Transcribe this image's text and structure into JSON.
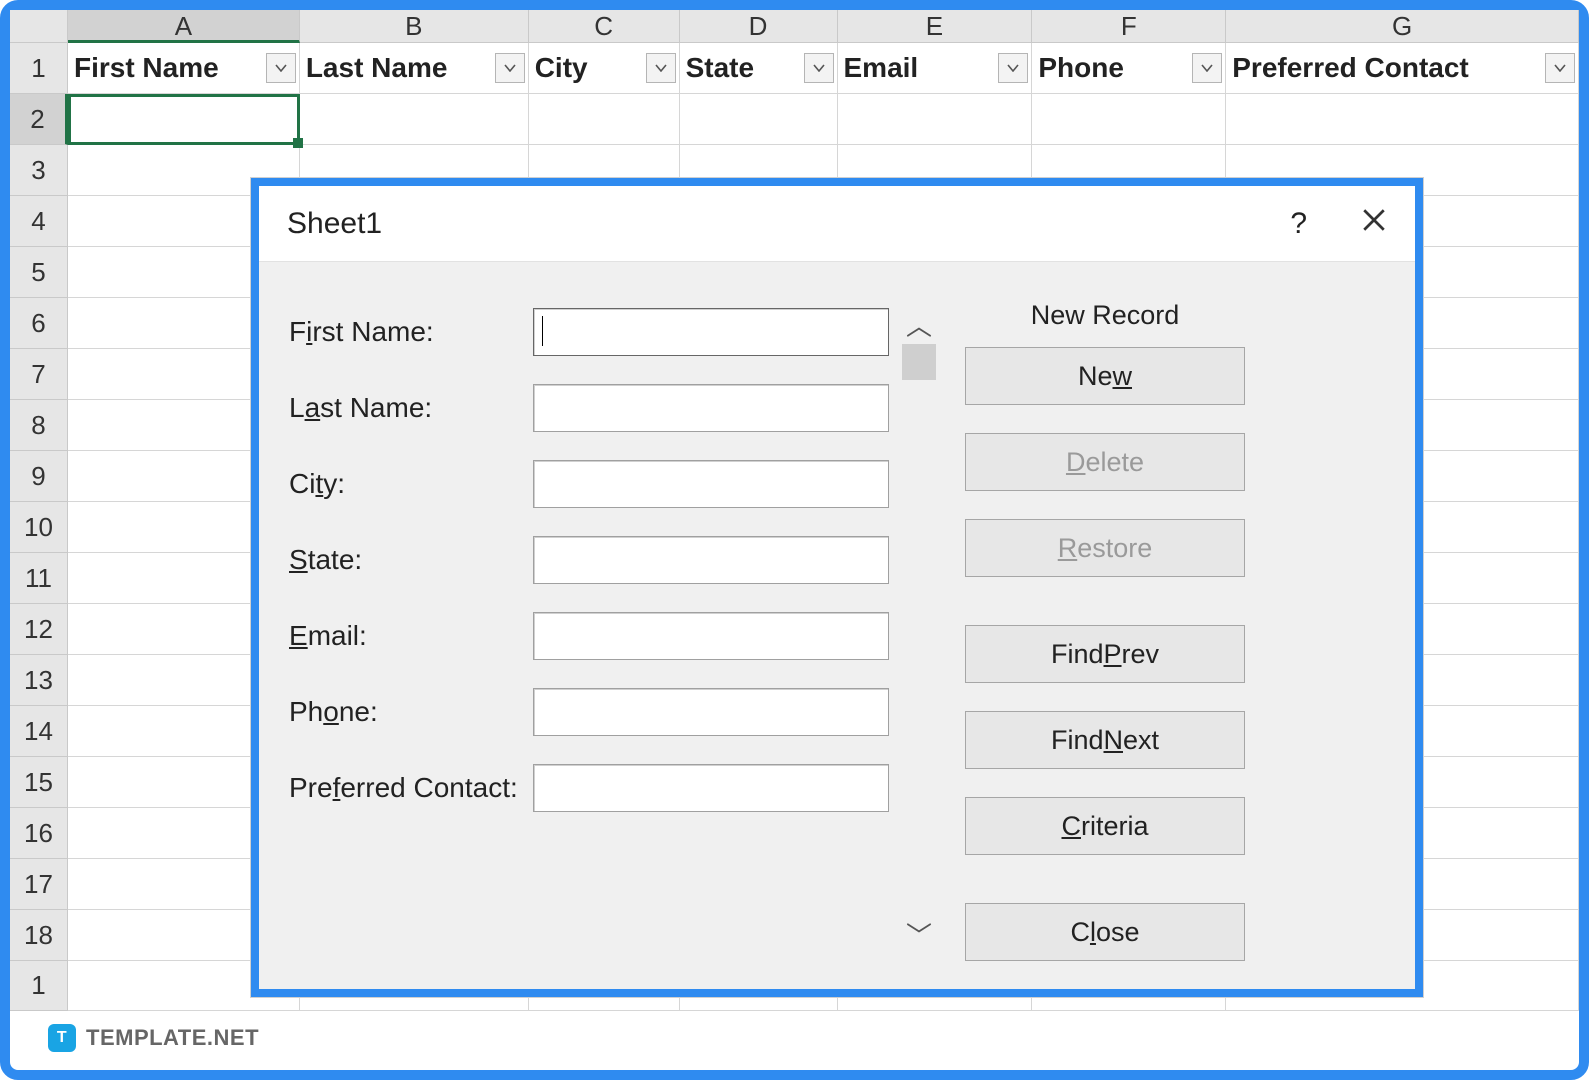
{
  "spreadsheet": {
    "columns": [
      "A",
      "B",
      "C",
      "D",
      "E",
      "F",
      "G"
    ],
    "selected_col": "A",
    "row_numbers": [
      "1",
      "2",
      "3",
      "4",
      "5",
      "6",
      "7",
      "8",
      "9",
      "10",
      "11",
      "12",
      "13",
      "14",
      "15",
      "16",
      "17",
      "18",
      "1"
    ],
    "selected_row": "2",
    "headers": [
      "First Name",
      "Last Name",
      "City",
      "State",
      "Email",
      "Phone",
      "Preferred Contact"
    ]
  },
  "dialog": {
    "title": "Sheet1",
    "help_symbol": "?",
    "status": "New Record",
    "fields": [
      {
        "label_pre": "F",
        "label_ul": "i",
        "label_post": "rst Name:",
        "focused": true
      },
      {
        "label_pre": "L",
        "label_ul": "a",
        "label_post": "st Name:"
      },
      {
        "label_pre": "Ci",
        "label_ul": "t",
        "label_post": "y:"
      },
      {
        "label_pre": "",
        "label_ul": "S",
        "label_post": "tate:"
      },
      {
        "label_pre": "",
        "label_ul": "E",
        "label_post": "mail:"
      },
      {
        "label_pre": "Ph",
        "label_ul": "o",
        "label_post": "ne:"
      },
      {
        "label_pre": "Pre",
        "label_ul": "f",
        "label_post": "erred Contact:"
      }
    ],
    "buttons": {
      "new_pre": "Ne",
      "new_ul": "w",
      "new_post": "",
      "delete_pre": "",
      "delete_ul": "D",
      "delete_post": "elete",
      "restore_pre": "",
      "restore_ul": "R",
      "restore_post": "estore",
      "findprev_pre": "Find ",
      "findprev_ul": "P",
      "findprev_post": "rev",
      "findnext_pre": "Find ",
      "findnext_ul": "N",
      "findnext_post": "ext",
      "criteria_pre": "",
      "criteria_ul": "C",
      "criteria_post": "riteria",
      "close_pre": "C",
      "close_ul": "l",
      "close_post": "ose"
    }
  },
  "watermark": {
    "text": "TEMPLATE.NET",
    "badge": "T"
  }
}
